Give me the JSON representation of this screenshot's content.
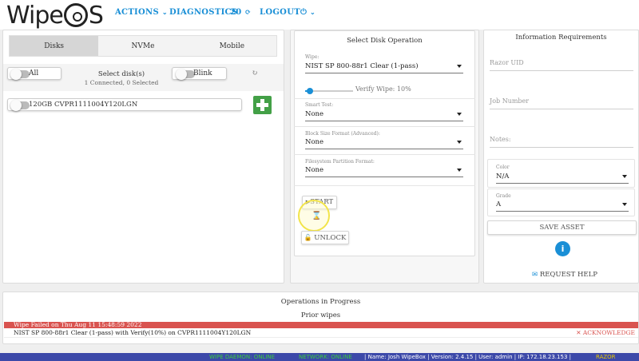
{
  "header": {
    "logo_prefix": "Wipe",
    "logo_suffix": "S",
    "actions": "ACTIONS",
    "diagnostics": "DIAGNOSTICS",
    "counter": "20",
    "logout": "LOGOUT"
  },
  "disks": {
    "tabs": [
      "Disks",
      "NVMe",
      "Mobile"
    ],
    "all_label": "All",
    "select_title": "Select disk(s)",
    "select_count": "1 Connected, 0 Selected",
    "blink_label": "Blink",
    "disk_item": "120GB CVPR1111004Y120LGN"
  },
  "operation": {
    "title": "Select Disk Operation",
    "wipe_label": "Wipe:",
    "wipe_value": "NIST SP 800-88r1 Clear (1-pass)",
    "verify_label": "Verify Wipe: 10%",
    "verify_fraction": 0.1,
    "smart_label": "Smart Test:",
    "smart_value": "None",
    "block_label": "Block Size Format (Advanced):",
    "block_value": "None",
    "fs_label": "Filesystem Partition Format:",
    "fs_value": "None",
    "start_label": "START",
    "unlock_label": "UNLOCK"
  },
  "info": {
    "title": "Information Requirements",
    "razor_uid": "Razor UID",
    "job_number": "Job Number",
    "notes": "Notes:",
    "color_label": "Color",
    "color_value": "N/A",
    "grade_label": "Grade",
    "grade_value": "A",
    "save_asset": "SAVE ASSET",
    "request_help": "REQUEST HELP"
  },
  "progress": {
    "ops_title": "Operations in Progress",
    "prior_title": "Prior wipes",
    "fail_banner": "Wipe Failed on Thu Aug 11 15:48:59 2022",
    "fail_detail": "NIST SP 800-88r1 Clear (1-pass) with Verify(10%) on CVPR1111004Y120LGN",
    "acknowledge": "ACKNOWLEDGE"
  },
  "status_bar": {
    "daemon": "WIPE DAEMON: ONLINE",
    "network": "NETWORK: ONLINE",
    "info": "| Name: Josh WipeBox | Version: 2.4.15 | User: admin | IP: 172.18.23.153 |",
    "razor": "RAZOR"
  },
  "colors": {
    "accent": "#1a8fd6",
    "fail_red": "#d9534f",
    "add_green": "#43a047",
    "status_blue": "#3c49a9",
    "online_green": "#3ccf3c",
    "razor_yellow": "#e6c700"
  }
}
